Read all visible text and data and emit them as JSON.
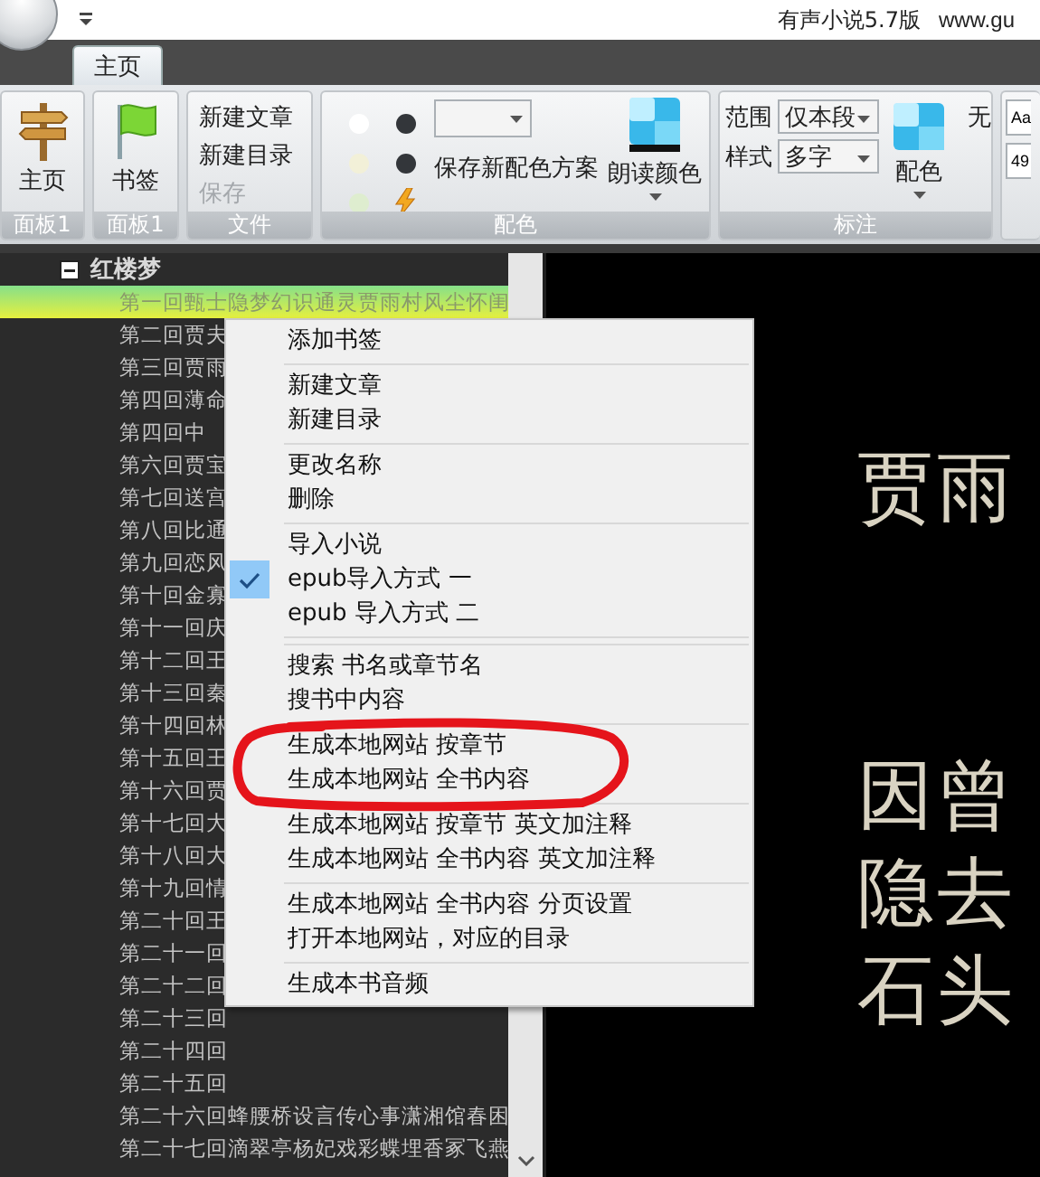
{
  "title_bar": {
    "title": "有声小说5.7版",
    "url": "www.gu"
  },
  "tabs": [
    {
      "label": "主页",
      "selected": true
    }
  ],
  "ribbon": {
    "groups": [
      {
        "kind": "home",
        "label": "面板1",
        "button": "主页"
      },
      {
        "kind": "bookmark",
        "label": "面板1",
        "button": "书签"
      },
      {
        "kind": "file",
        "label": "文件",
        "buttons": [
          {
            "label": "新建文章",
            "disabled": false
          },
          {
            "label": "新建目录",
            "disabled": false
          },
          {
            "label": "保存",
            "disabled": true
          }
        ]
      },
      {
        "kind": "colors",
        "label": "配色",
        "swatches": [
          {
            "color": "#ffffff"
          },
          {
            "color": "#33363a"
          },
          {
            "color": "#f2f0d8"
          },
          {
            "color": "#33363a"
          },
          {
            "color": "#deedcf"
          }
        ],
        "save_button": "保存新配色方案",
        "read_color_button": "朗读颜色"
      },
      {
        "kind": "annotation",
        "label": "标注",
        "fields": [
          {
            "label": "范围",
            "value": "仅本段"
          },
          {
            "label": "样式",
            "value": "多字"
          }
        ],
        "color_button": "配色",
        "none_label": "无"
      },
      {
        "kind": "partial",
        "fields": [
          "Aa",
          "49"
        ]
      }
    ]
  },
  "tree": {
    "title": "红楼梦",
    "expanded": true,
    "items": [
      {
        "label": "第一回甄士隐梦幻识通灵贾雨村风尘怀闺",
        "selected": true
      },
      {
        "label": "第二回贾夫",
        "selected": false
      },
      {
        "label": "第三回贾雨",
        "selected": false
      },
      {
        "label": "第四回薄命",
        "selected": false
      },
      {
        "label": "第四回中",
        "selected": false
      },
      {
        "label": "第六回贾宝",
        "selected": false
      },
      {
        "label": "第七回送宫",
        "selected": false
      },
      {
        "label": "第八回比通",
        "selected": false
      },
      {
        "label": "第九回恋风",
        "selected": false
      },
      {
        "label": "第十回金寡",
        "selected": false
      },
      {
        "label": "第十一回庆",
        "selected": false
      },
      {
        "label": "第十二回王",
        "selected": false
      },
      {
        "label": "第十三回秦",
        "selected": false
      },
      {
        "label": "第十四回林",
        "selected": false
      },
      {
        "label": "第十五回王",
        "selected": false
      },
      {
        "label": "第十六回贾",
        "selected": false
      },
      {
        "label": "第十七回大",
        "selected": false
      },
      {
        "label": "第十八回大",
        "selected": false
      },
      {
        "label": "第十九回情",
        "selected": false
      },
      {
        "label": "第二十回王",
        "selected": false
      },
      {
        "label": "第二十一回",
        "selected": false
      },
      {
        "label": "第二十二回",
        "selected": false
      },
      {
        "label": "第二十三回",
        "selected": false
      },
      {
        "label": "第二十四回",
        "selected": false
      },
      {
        "label": "第二十五回",
        "selected": false
      },
      {
        "label": "第二十六回蜂腰桥设言传心事潇湘馆春困",
        "selected": false
      },
      {
        "label": "第二十七回滴翠亭杨妃戏彩蝶埋香冢飞燕",
        "selected": false
      }
    ]
  },
  "canvas": {
    "lines": [
      "贾雨",
      "因曾",
      "隐去",
      "石头"
    ]
  },
  "menu": {
    "items": [
      {
        "kind": "item",
        "label": "添加书签",
        "checked": false
      },
      {
        "kind": "separator"
      },
      {
        "kind": "item",
        "label": "新建文章",
        "checked": false
      },
      {
        "kind": "item",
        "label": "新建目录",
        "checked": false
      },
      {
        "kind": "separator"
      },
      {
        "kind": "item",
        "label": "更改名称",
        "checked": false
      },
      {
        "kind": "item",
        "label": "删除",
        "checked": false
      },
      {
        "kind": "separator"
      },
      {
        "kind": "item",
        "label": "导入小说",
        "checked": false
      },
      {
        "kind": "item",
        "label": "epub导入方式 一",
        "checked": true
      },
      {
        "kind": "item",
        "label": "epub 导入方式 二",
        "checked": false
      },
      {
        "kind": "separator"
      },
      {
        "kind": "separator"
      },
      {
        "kind": "item",
        "label": "搜索 书名或章节名",
        "checked": false
      },
      {
        "kind": "item",
        "label": "搜书中内容",
        "checked": false
      },
      {
        "kind": "separator"
      },
      {
        "kind": "item",
        "label": "生成本地网站 按章节",
        "checked": false
      },
      {
        "kind": "item",
        "label": "生成本地网站 全书内容",
        "checked": false
      },
      {
        "kind": "separator"
      },
      {
        "kind": "item",
        "label": "生成本地网站 按章节 英文加注释",
        "checked": false
      },
      {
        "kind": "item",
        "label": "生成本地网站 全书内容 英文加注释",
        "checked": false
      },
      {
        "kind": "separator"
      },
      {
        "kind": "item",
        "label": "生成本地网站 全书内容 分页设置",
        "checked": false
      },
      {
        "kind": "item",
        "label": "打开本地网站，对应的目录",
        "checked": false
      },
      {
        "kind": "separator"
      },
      {
        "kind": "item",
        "label": "生成本书音频",
        "checked": false
      }
    ]
  }
}
